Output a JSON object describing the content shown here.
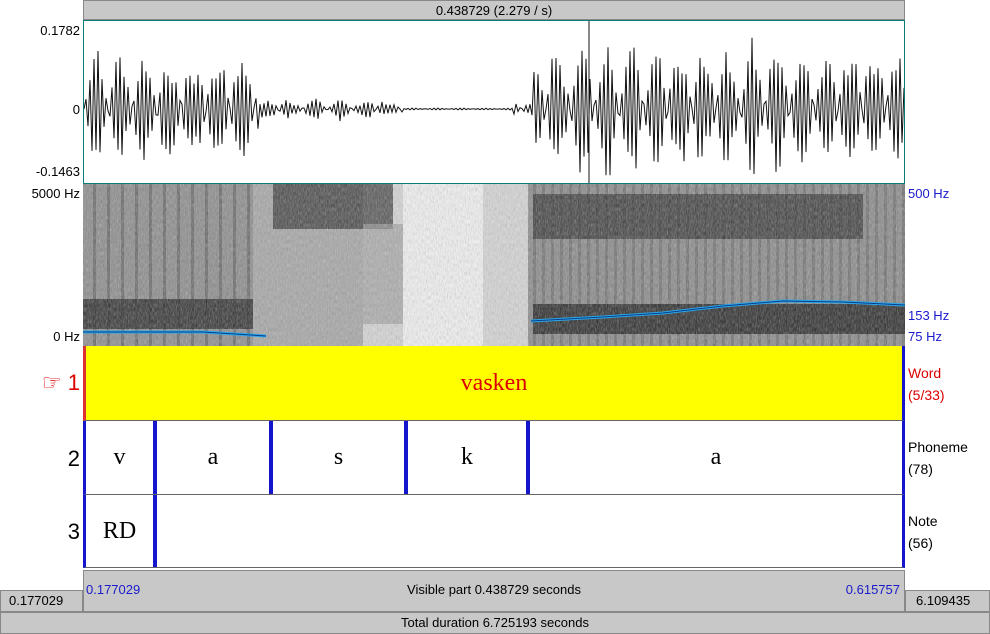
{
  "header": {
    "selection": "0.438729 (2.279 / s)"
  },
  "waveform": {
    "ymax": "0.1782",
    "yzero": "0",
    "ymin": "-0.1463"
  },
  "spectrogram": {
    "freq_top": "5000 Hz",
    "freq_bottom": "0 Hz",
    "pitch_top": "500 Hz",
    "pitch_mid": "153 Hz",
    "pitch_bottom": "75 Hz"
  },
  "tiers": [
    {
      "num": "1",
      "name": "Word",
      "count": "(5/33)",
      "pointer": "☞",
      "segments": [
        "vasken"
      ]
    },
    {
      "num": "2",
      "name": "Phoneme",
      "count": "(78)",
      "segments": [
        "v",
        "a",
        "s",
        "k",
        "a"
      ]
    },
    {
      "num": "3",
      "name": "Note",
      "count": "(56)",
      "segments": [
        "RD"
      ]
    }
  ],
  "footer": {
    "left_outer": "0.177029",
    "left_inner": "0.177029",
    "visible": "Visible part 0.438729 seconds",
    "right_inner": "0.615757",
    "right_outer": "6.109435",
    "total": "Total duration 6.725193 seconds"
  },
  "colors": {
    "tier_highlight": "#ffff00",
    "boundary": "#1515cc",
    "pitch": "#2aa8e8",
    "selected": "#dd0000"
  }
}
